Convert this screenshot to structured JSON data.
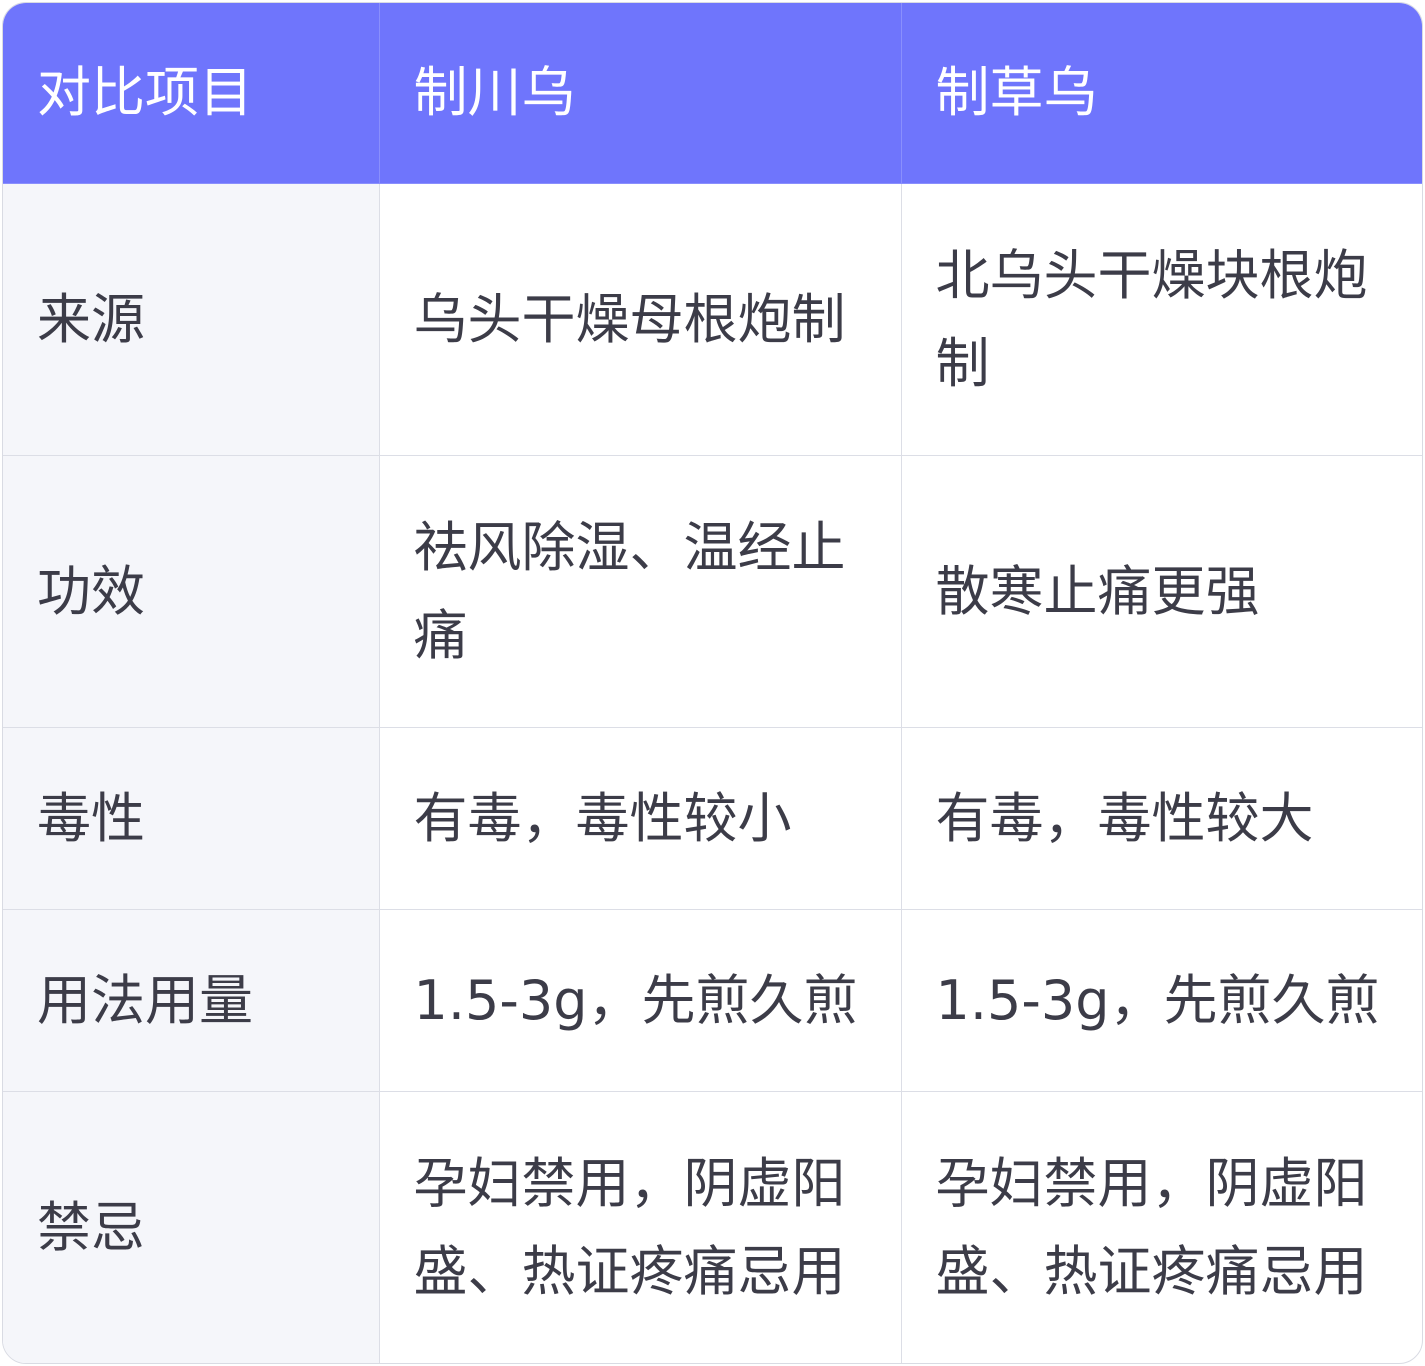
{
  "header": {
    "item": "对比项目",
    "col1": "制川乌",
    "col2": "制草乌"
  },
  "rows": [
    {
      "label": "来源",
      "col1": "乌头干燥母根炮制",
      "col2": "北乌头干燥块根炮制"
    },
    {
      "label": "功效",
      "col1": "祛风除湿、温经止痛",
      "col2": "散寒止痛更强"
    },
    {
      "label": "毒性",
      "col1": "有毒，毒性较小",
      "col2": "有毒，毒性较大"
    },
    {
      "label": "用法用量",
      "col1": "1.5-3g，先煎久煎",
      "col2": "1.5-3g，先煎久煎"
    },
    {
      "label": "禁忌",
      "col1": "孕妇禁用，阴虚阳盛、热证疼痛忌用",
      "col2": "孕妇禁用，阴虚阳盛、热证疼痛忌用"
    }
  ],
  "colors": {
    "header_bg": "#6f75fc",
    "label_bg": "#f5f6fa",
    "text": "#3c3c48"
  }
}
